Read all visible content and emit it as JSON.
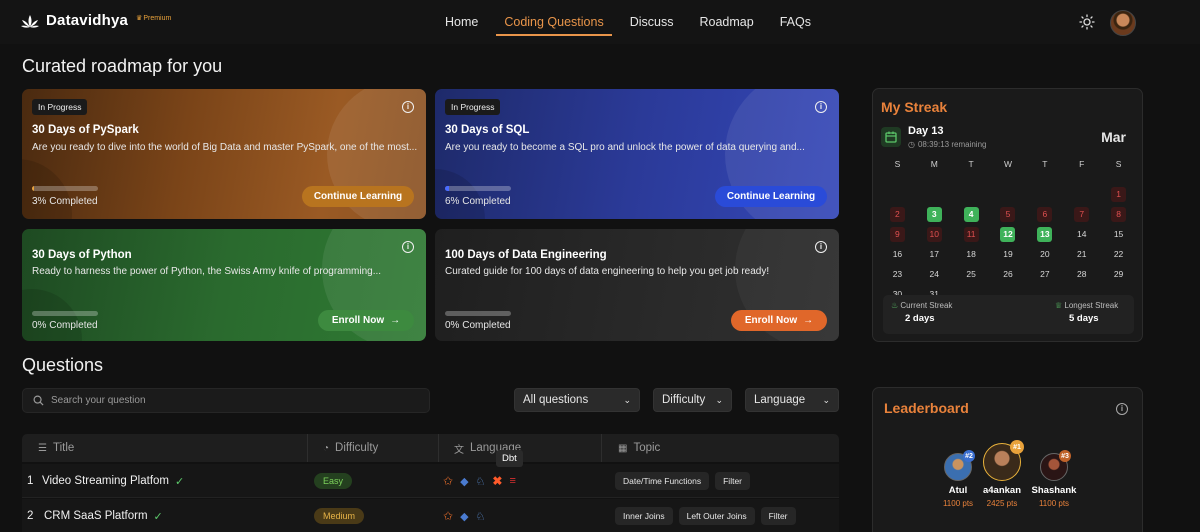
{
  "nav": {
    "logo": "Datavidhya",
    "premium": "Premium",
    "links": [
      "Home",
      "Coding Questions",
      "Discuss",
      "Roadmap",
      "FAQs"
    ],
    "active_link": "Coding Questions"
  },
  "roadmap": {
    "heading": "Curated roadmap for you",
    "cards": [
      {
        "badge": "In Progress",
        "title": "30 Days of PySpark",
        "desc": "Are you ready to dive into the world of Big Data and master PySpark, one of the most...",
        "progress": 3,
        "progress_label": "3% Completed",
        "button": "Continue Learning",
        "button_color": "#b8741f"
      },
      {
        "badge": "In Progress",
        "title": "30 Days of SQL",
        "desc": "Are you ready to become a SQL pro and unlock the power of data querying and...",
        "progress": 6,
        "progress_label": "6% Completed",
        "button": "Continue Learning",
        "button_color": "#2a4bd8"
      },
      {
        "badge": "",
        "title": "30 Days of Python",
        "desc": "Ready to harness the power of Python, the Swiss Army knife of programming...",
        "progress": 0,
        "progress_label": "0% Completed",
        "button": "Enroll Now",
        "button_color": "#3d8a3f"
      },
      {
        "badge": "",
        "title": "100 Days of Data Engineering",
        "desc": "Curated guide for 100 days of data engineering to help you get job ready!",
        "progress": 0,
        "progress_label": "0% Completed",
        "button": "Enroll Now",
        "button_color": "#e0672a"
      }
    ]
  },
  "streak": {
    "title": "My Streak",
    "day": "Day 13",
    "remaining": "08:39:13 remaining",
    "month": "Mar",
    "weekdays": [
      "S",
      "M",
      "T",
      "W",
      "T",
      "F",
      "S"
    ],
    "leading_blanks": 6,
    "days": 31,
    "green_days": [
      3,
      4,
      12,
      13
    ],
    "red_days": [
      1,
      2,
      5,
      6,
      7,
      8,
      9,
      10,
      11
    ],
    "current_label": "Current Streak",
    "current_value": "2 days",
    "longest_label": "Longest Streak",
    "longest_value": "5 days"
  },
  "questions": {
    "heading": "Questions",
    "search_placeholder": "Search your question",
    "filters": [
      "All questions",
      "Difficulty",
      "Language"
    ],
    "columns": [
      "Title",
      "Difficulty",
      "Language",
      "Topic"
    ],
    "tooltip": "Dbt",
    "rows": [
      {
        "num": "1",
        "title": "Video Streaming Platfom",
        "difficulty": "Easy",
        "diff_bg": "#24401f",
        "diff_fg": "#7dd35b",
        "topics": [
          "Date/Time Functions",
          "Filter"
        ],
        "langs": [
          "spark",
          "python",
          "postgres",
          "dbt",
          "database"
        ]
      },
      {
        "num": "2",
        "title": "CRM SaaS Platform",
        "difficulty": "Medium",
        "diff_bg": "#4a3a17",
        "diff_fg": "#e7b347",
        "topics": [
          "Inner Joins",
          "Left Outer Joins",
          "Filter"
        ],
        "langs": [
          "spark",
          "python",
          "postgres"
        ]
      }
    ]
  },
  "leaderboard": {
    "title": "Leaderboard",
    "users": [
      {
        "name": "Atul",
        "pts": "1100 pts",
        "rank": "#2"
      },
      {
        "name": "a4ankan",
        "pts": "2425 pts",
        "rank": "#1"
      },
      {
        "name": "Shashank",
        "pts": "1100 pts",
        "rank": "#3"
      }
    ]
  }
}
